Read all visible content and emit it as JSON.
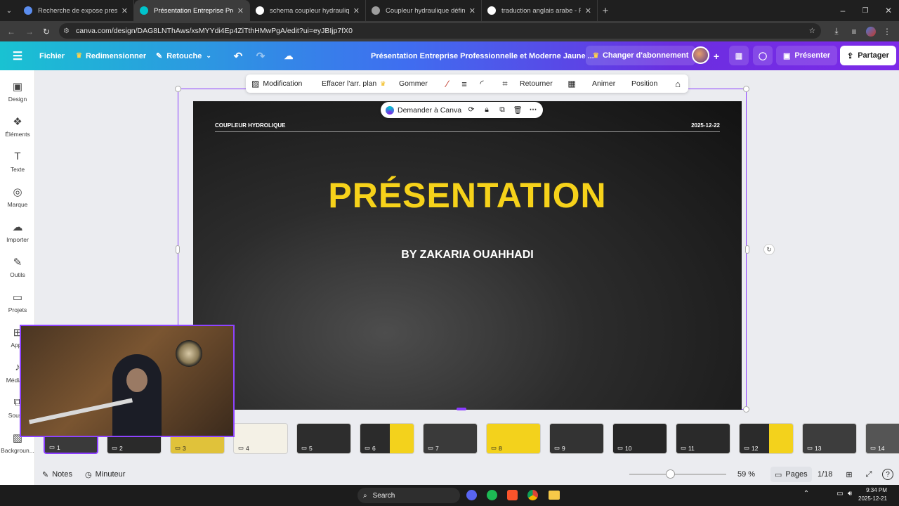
{
  "browser": {
    "tabs": [
      {
        "title": "Recherche de expose presentat",
        "fav": "#5b8def"
      },
      {
        "title": "Présentation Entreprise Profess",
        "fav": "#00c4cc"
      },
      {
        "title": "schema coupleur hydraulique -",
        "fav": "#ffffff"
      },
      {
        "title": "Coupleur hydraulique définitio",
        "fav": "#9e9e9e"
      },
      {
        "title": "traduction anglais arabe - Rech",
        "fav": "#ffffff"
      }
    ],
    "url": "canva.com/design/DAG8LNThAws/xsMYYdi4Ep4ZiTthHMwPgA/edit?ui=eyJBIjp7fX0"
  },
  "canva_header": {
    "file": "Fichier",
    "resize": "Redimensionner",
    "retouch": "Retouche",
    "title": "Présentation Entreprise Professionnelle et Moderne Jaune ...",
    "upgrade": "Changer d'abonnement",
    "present": "Présenter",
    "share": "Partager"
  },
  "sidebar": [
    {
      "label": "Design",
      "icon": "design-icon"
    },
    {
      "label": "Éléments",
      "icon": "elements-icon"
    },
    {
      "label": "Texte",
      "icon": "text-icon"
    },
    {
      "label": "Marque",
      "icon": "brand-icon"
    },
    {
      "label": "Importer",
      "icon": "upload-icon"
    },
    {
      "label": "Outils",
      "icon": "tools-icon"
    },
    {
      "label": "Projets",
      "icon": "folder-icon"
    },
    {
      "label": "Apps",
      "icon": "apps-icon"
    },
    {
      "label": "Média m",
      "icon": "media-icon"
    },
    {
      "label": "Sous-ti",
      "icon": "subtitles-icon"
    },
    {
      "label": "Backgroun...",
      "icon": "background-icon"
    }
  ],
  "context_toolbar": {
    "edit": "Modification",
    "remove_bg": "Effacer l'arr. plan",
    "erase": "Gommer",
    "flip": "Retourner",
    "animate": "Animer",
    "position": "Position"
  },
  "ask_canva": "Demander à Canva",
  "slide": {
    "header_left": "COUPLEUR HYDROLIQUE",
    "header_right": "2025-12-22",
    "title": "PRÉSENTATION",
    "subtitle": "BY ZAKARIA OUAHHADI",
    "title_color": "#f6d21a"
  },
  "thumbnails": [
    {
      "n": "1",
      "bg": "#3a3a3a",
      "style": "dark"
    },
    {
      "n": "2",
      "bg": "#2a2a2a",
      "style": "dark"
    },
    {
      "n": "3",
      "bg": "#e0c23a",
      "style": "yellow"
    },
    {
      "n": "4",
      "bg": "#f4f1e6",
      "style": "yellow"
    },
    {
      "n": "5",
      "bg": "#2d2d2d",
      "style": "dark"
    },
    {
      "n": "6",
      "bg": "#2d2d2d",
      "style": "split"
    },
    {
      "n": "7",
      "bg": "#3a3a3a",
      "style": "dark"
    },
    {
      "n": "8",
      "bg": "#f3d21c",
      "style": "yellow"
    },
    {
      "n": "9",
      "bg": "#333333",
      "style": "dark"
    },
    {
      "n": "10",
      "bg": "#262626",
      "style": "dark"
    },
    {
      "n": "11",
      "bg": "#2a2a2a",
      "style": "dark"
    },
    {
      "n": "12",
      "bg": "#f3d21c",
      "style": "split"
    },
    {
      "n": "13",
      "bg": "#3d3d3d",
      "style": "dark"
    },
    {
      "n": "14",
      "bg": "#555555",
      "style": "dark"
    }
  ],
  "bottom": {
    "notes": "Notes",
    "timer": "Minuteur",
    "zoom": "59 %",
    "zoom_fraction": 0.42,
    "pages": "Pages",
    "page_count": "1/18"
  },
  "taskbar": {
    "search": "Search",
    "time": "9:34 PM",
    "date": "2025-12-21"
  }
}
